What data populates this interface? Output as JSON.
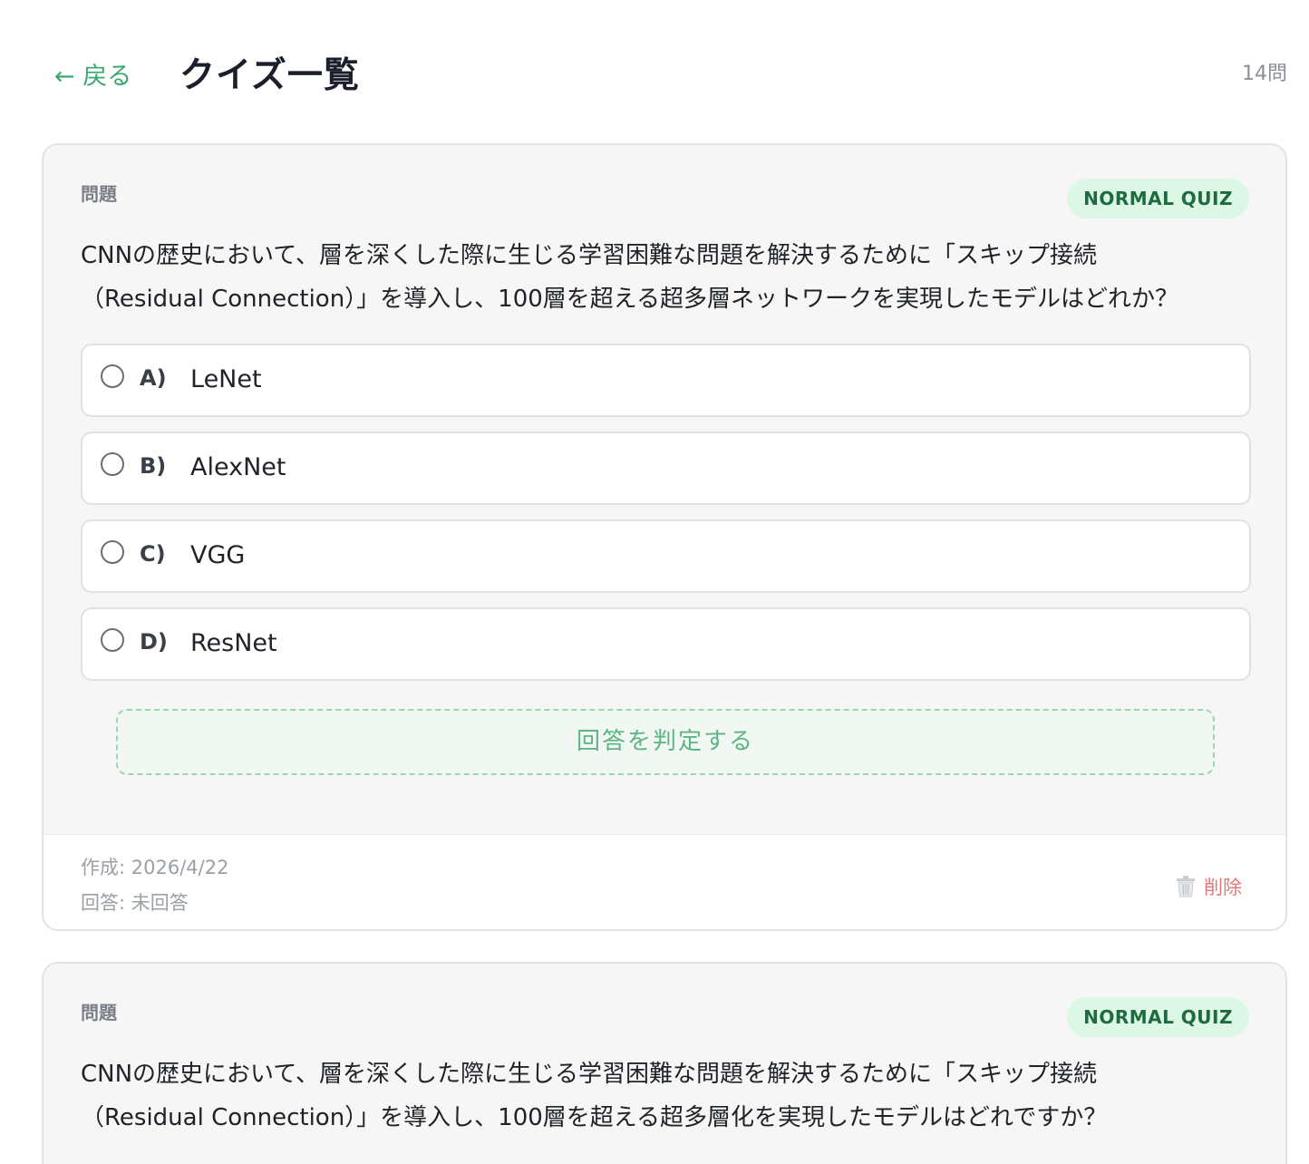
{
  "header": {
    "back_label": "← 戻る",
    "title": "クイズ一覧",
    "count": "14問"
  },
  "cards": [
    {
      "question_label": "問題",
      "badge": "NORMAL QUIZ",
      "question_line1": "CNNの歴史において、層を深くした際に生じる学習困難な問題を解決するために「スキップ接続",
      "question_line2": "（Residual Connection）」を導入し、100層を超える超多層ネットワークを実現したモデルはどれか？",
      "options": [
        {
          "letter": "A)",
          "text": "LeNet"
        },
        {
          "letter": "B)",
          "text": "AlexNet"
        },
        {
          "letter": "C)",
          "text": "VGG"
        },
        {
          "letter": "D)",
          "text": "ResNet"
        }
      ],
      "judge_label": "回答を判定する",
      "created": "作成: 2026/4/22",
      "answer_status": "回答: 未回答",
      "delete_label": "削除"
    },
    {
      "question_label": "問題",
      "badge": "NORMAL QUIZ",
      "question_line1": "CNNの歴史において、層を深くした際に生じる学習困難な問題を解決するために「スキップ接続",
      "question_line2": "（Residual Connection）」を導入し、100層を超える超多層化を実現したモデルはどれですか？"
    }
  ],
  "colors": {
    "accent": "#3aa971",
    "badge_bg": "#dcf7e6",
    "badge_text": "#1e6b3f",
    "delete": "#e07a7a"
  },
  "icons": {
    "delete": "trash-icon"
  }
}
